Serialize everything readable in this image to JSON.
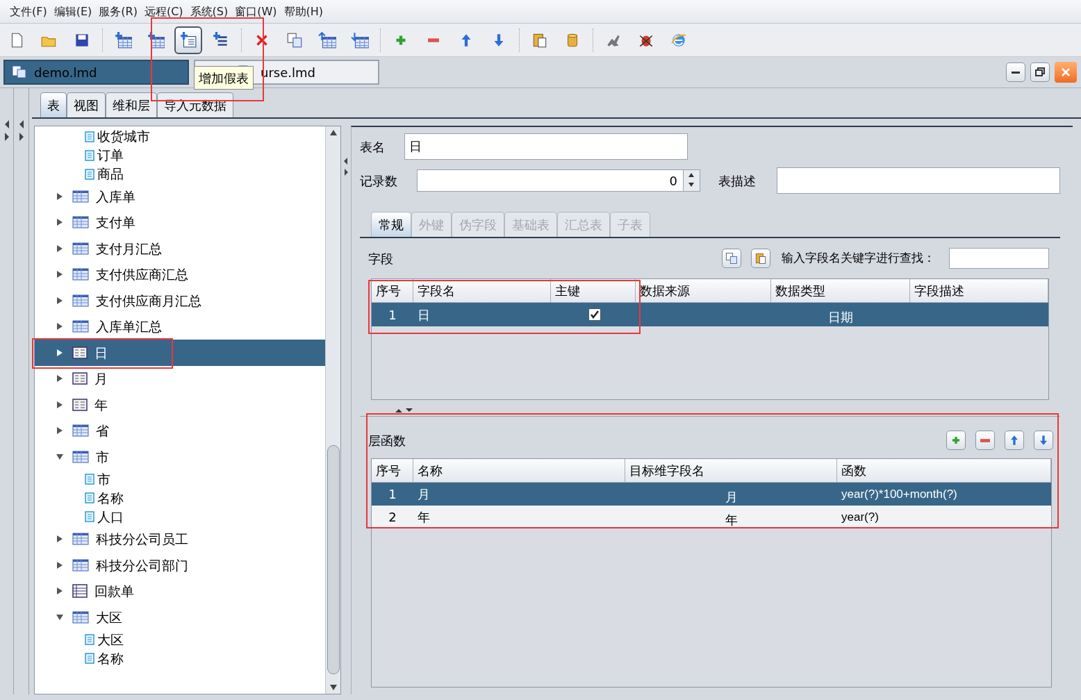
{
  "menu": [
    "文件(F)",
    "编辑(E)",
    "服务(R)",
    "远程(C)",
    "系统(S)",
    "窗口(W)",
    "帮助(H)"
  ],
  "toolbar": {
    "tooltip": "增加假表",
    "buttons": [
      {
        "kind": "new",
        "hovered": false
      },
      {
        "kind": "open",
        "hovered": false
      },
      {
        "kind": "save",
        "hovered": false
      },
      {
        "kind": "separator"
      },
      {
        "kind": "add-table",
        "hovered": false
      },
      {
        "kind": "add-sql-table",
        "hovered": false
      },
      {
        "kind": "add-fake-table",
        "hovered": true
      },
      {
        "kind": "add-child",
        "hovered": false
      },
      {
        "kind": "separator"
      },
      {
        "kind": "delete",
        "hovered": false
      },
      {
        "kind": "copy",
        "hovered": false
      },
      {
        "kind": "table-up",
        "hovered": false
      },
      {
        "kind": "table-down",
        "hovered": false
      },
      {
        "kind": "separator"
      },
      {
        "kind": "add",
        "hovered": false
      },
      {
        "kind": "remove",
        "hovered": false
      },
      {
        "kind": "up",
        "hovered": false
      },
      {
        "kind": "down",
        "hovered": false
      },
      {
        "kind": "separator"
      },
      {
        "kind": "paste",
        "hovered": false
      },
      {
        "kind": "database",
        "hovered": false
      },
      {
        "kind": "separator"
      },
      {
        "kind": "tool",
        "hovered": false
      },
      {
        "kind": "bug",
        "hovered": false
      },
      {
        "kind": "globe",
        "hovered": false
      }
    ]
  },
  "documents": [
    {
      "label": "demo.lmd",
      "selected": true
    },
    {
      "label": "urse.lmd",
      "selected": false
    }
  ],
  "tabs": [
    {
      "label": "表",
      "selected": true
    },
    {
      "label": "视图",
      "selected": false
    },
    {
      "label": "维和层",
      "selected": false
    },
    {
      "label": "导入元数据",
      "selected": false
    }
  ],
  "tree": {
    "items": [
      {
        "label": "收货城市",
        "kind": "field",
        "selected": false
      },
      {
        "label": "订单",
        "kind": "field",
        "selected": false
      },
      {
        "label": "商品",
        "kind": "field",
        "selected": false
      },
      {
        "label": "入库单",
        "kind": "table",
        "expanded": false,
        "selected": false
      },
      {
        "label": "支付单",
        "kind": "table",
        "expanded": false,
        "selected": false
      },
      {
        "label": "支付月汇总",
        "kind": "table",
        "expanded": false,
        "selected": false
      },
      {
        "label": "支付供应商汇总",
        "kind": "table",
        "expanded": false,
        "selected": false
      },
      {
        "label": "支付供应商月汇总",
        "kind": "table",
        "expanded": false,
        "selected": false
      },
      {
        "label": "入库单汇总",
        "kind": "table",
        "expanded": false,
        "selected": false
      },
      {
        "label": "日",
        "kind": "dimension",
        "expanded": false,
        "selected": true
      },
      {
        "label": "月",
        "kind": "dimension",
        "expanded": false,
        "selected": false
      },
      {
        "label": "年",
        "kind": "dimension",
        "expanded": false,
        "selected": false
      },
      {
        "label": "省",
        "kind": "table",
        "expanded": false,
        "selected": false
      },
      {
        "label": "市",
        "kind": "table",
        "expanded": true,
        "selected": false,
        "children": [
          {
            "label": "市",
            "kind": "field",
            "selected": false
          },
          {
            "label": "名称",
            "kind": "field",
            "selected": false
          },
          {
            "label": "人口",
            "kind": "field",
            "selected": false
          }
        ]
      },
      {
        "label": "科技分公司员工",
        "kind": "table",
        "expanded": false,
        "selected": false
      },
      {
        "label": "科技分公司部门",
        "kind": "table",
        "expanded": false,
        "selected": false
      },
      {
        "label": "回款单",
        "kind": "list",
        "expanded": false,
        "selected": false
      },
      {
        "label": "大区",
        "kind": "table",
        "expanded": true,
        "selected": false,
        "children": [
          {
            "label": "大区",
            "kind": "field",
            "selected": false
          },
          {
            "label": "名称",
            "kind": "field",
            "selected": false
          }
        ]
      }
    ]
  },
  "form": {
    "table_name": {
      "label": "表名",
      "value": "日"
    },
    "record_count": {
      "label": "记录数",
      "value": "0"
    },
    "description": {
      "label": "表描述"
    }
  },
  "subtabs": [
    {
      "label": "常规",
      "selected": true,
      "disabled": false
    },
    {
      "label": "外键",
      "selected": false,
      "disabled": true
    },
    {
      "label": "伪字段",
      "selected": false,
      "disabled": true
    },
    {
      "label": "基础表",
      "selected": false,
      "disabled": true
    },
    {
      "label": "汇总表",
      "selected": false,
      "disabled": true
    },
    {
      "label": "子表",
      "selected": false,
      "disabled": true
    }
  ],
  "fields": {
    "title": "字段",
    "search_label": "输入字段名关键字进行查找：",
    "columns": [
      "序号",
      "字段名",
      "主键",
      "数据来源",
      "数据类型",
      "字段描述"
    ],
    "rows": [
      {
        "index": "1",
        "name": "日",
        "primary_key": true,
        "type": "日期",
        "selected": true
      }
    ]
  },
  "levels": {
    "title": "层函数",
    "columns": [
      "序号",
      "名称",
      "目标维字段名",
      "函数"
    ],
    "rows": [
      {
        "index": "1",
        "name": "月",
        "target": "月",
        "function": "year(?)*100+month(?)",
        "selected": true
      },
      {
        "index": "2",
        "name": "年",
        "target": "年",
        "function": "year(?)",
        "selected": false
      }
    ]
  }
}
